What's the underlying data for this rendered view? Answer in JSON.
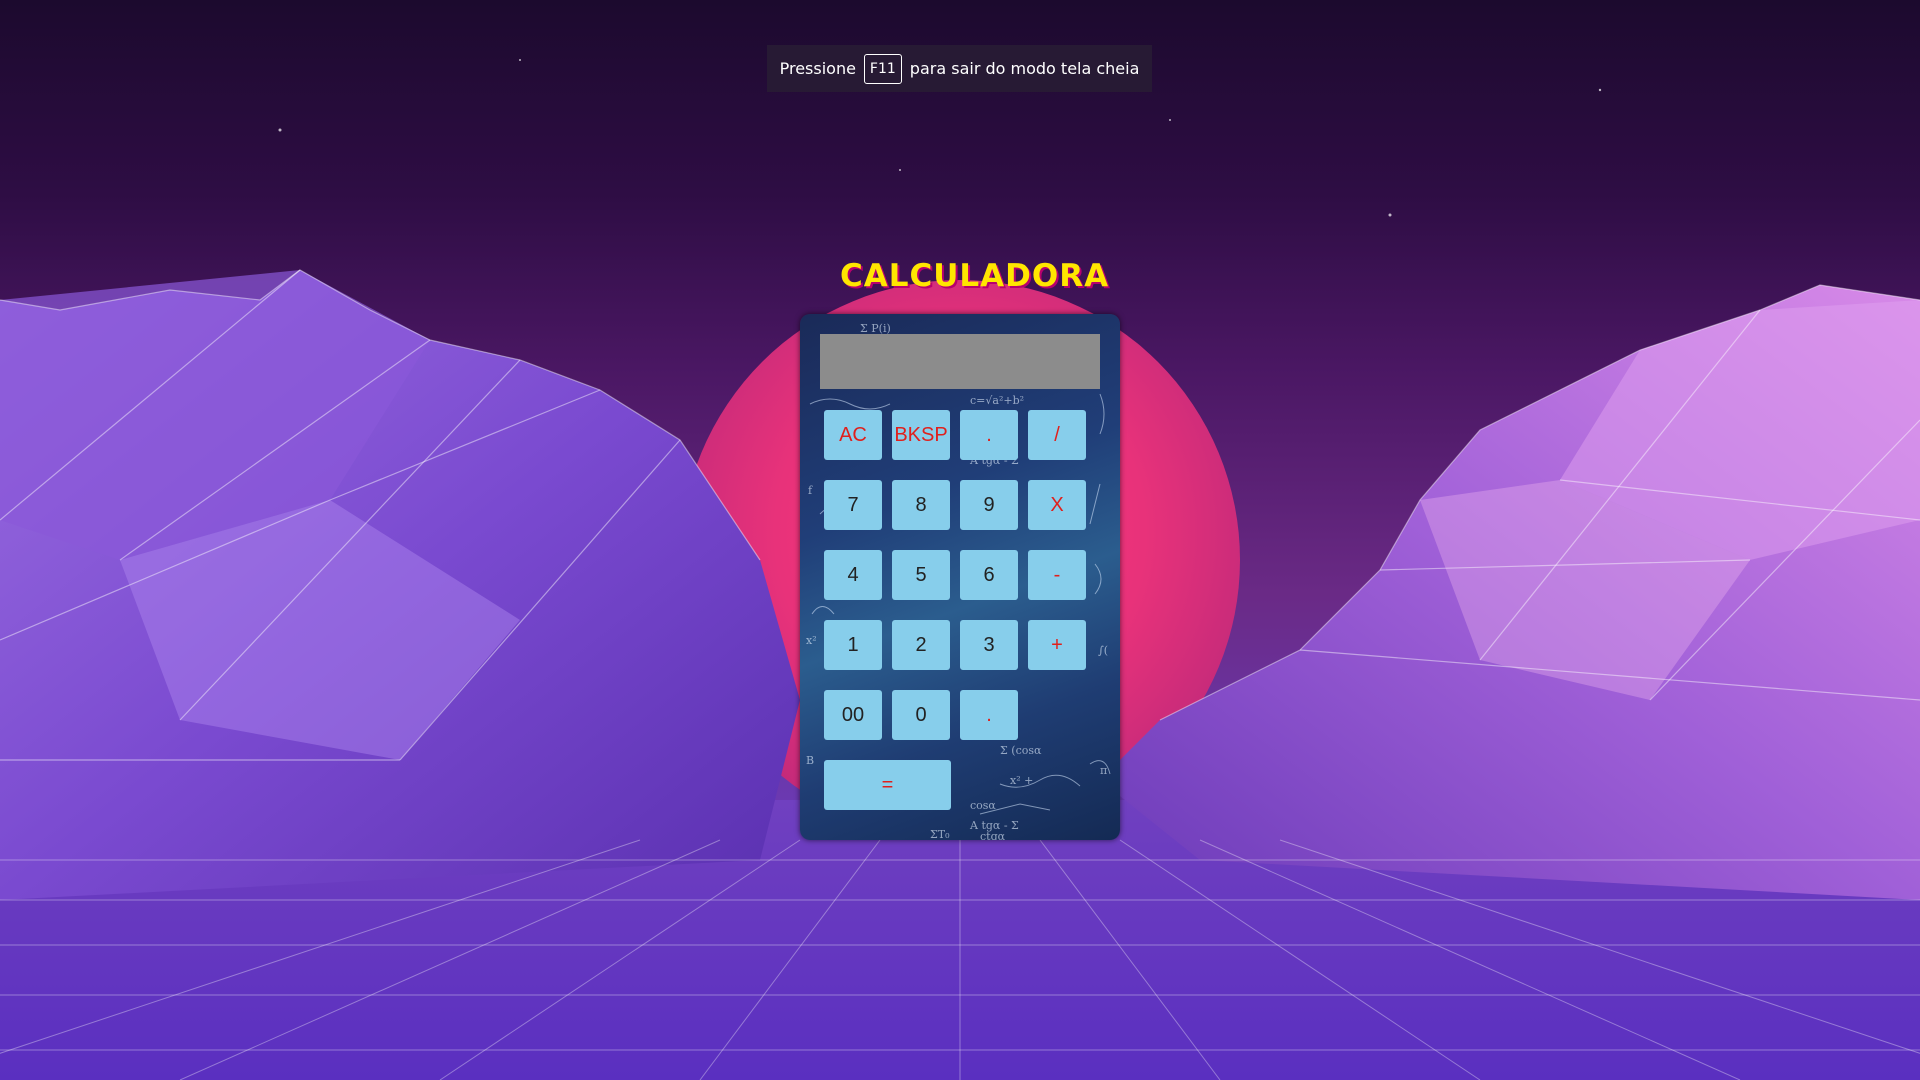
{
  "fullscreen_notice": {
    "prefix": "Pressione",
    "key": "F11",
    "suffix": "para sair do modo tela cheia"
  },
  "app": {
    "title": "CALCULADORA"
  },
  "calculator": {
    "display_value": "",
    "rows": [
      [
        "AC",
        "BKSP",
        ".",
        "/"
      ],
      [
        "7",
        "8",
        "9",
        "X"
      ],
      [
        "4",
        "5",
        "6",
        "-"
      ],
      [
        "1",
        "2",
        "3",
        "+"
      ],
      [
        "00",
        "0",
        "."
      ],
      [
        "="
      ]
    ]
  },
  "colors": {
    "button_bg": "#87ceeb",
    "operator_text": "#e0201c",
    "digit_text": "#222222",
    "display_bg": "#8c8c8c",
    "title": "#ffe600",
    "sun": "#e8327a"
  }
}
